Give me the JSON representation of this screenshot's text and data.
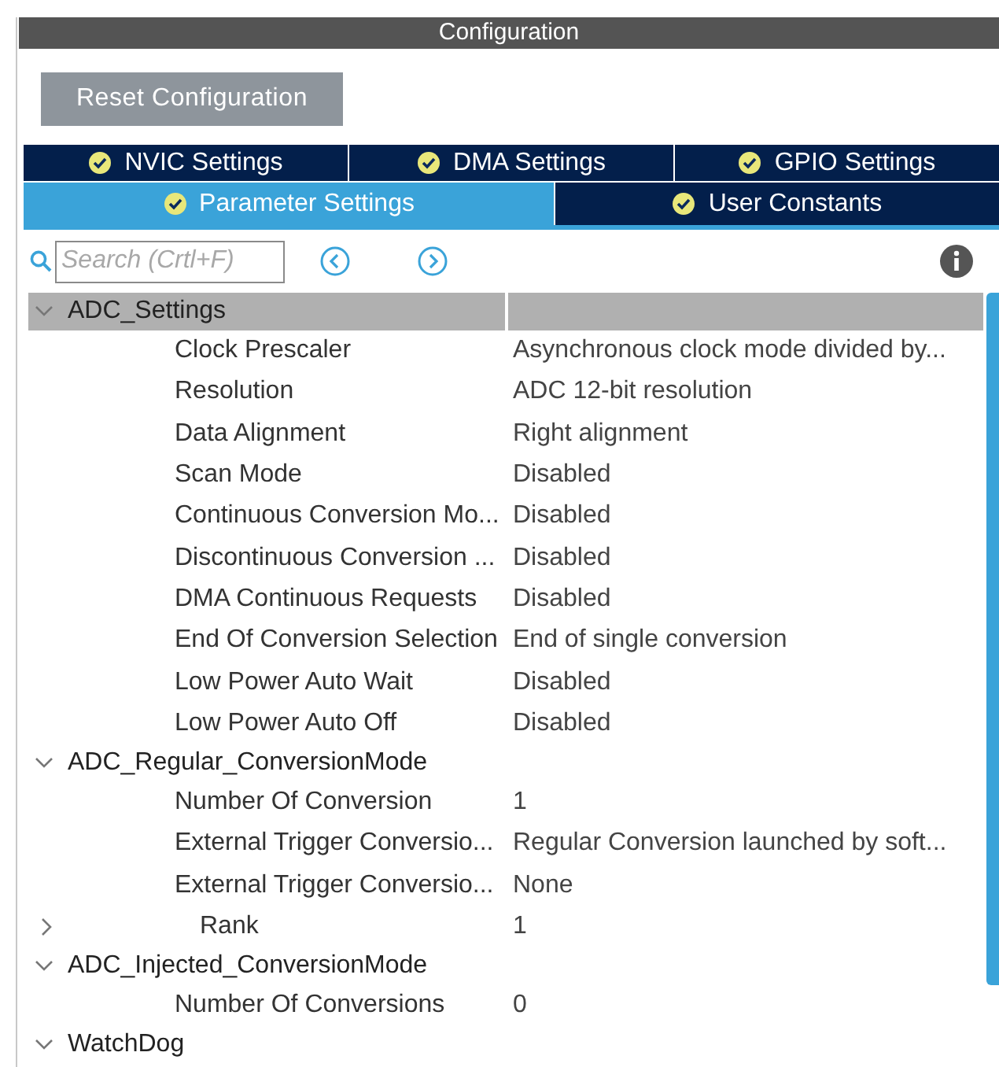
{
  "window": {
    "title": "Configuration"
  },
  "reset_button": "Reset Configuration",
  "tab_rows": [
    [
      {
        "label": "NVIC Settings",
        "selected": false
      },
      {
        "label": "DMA Settings",
        "selected": false
      },
      {
        "label": "GPIO Settings",
        "selected": false
      }
    ],
    [
      {
        "label": "Parameter Settings",
        "selected": true
      },
      {
        "label": "User Constants",
        "selected": false
      }
    ]
  ],
  "search": {
    "placeholder": "Search (Crtl+F)"
  },
  "tree": [
    {
      "label": "ADC_Settings",
      "expanded": true,
      "selected": true,
      "children": [
        {
          "label": "Clock Prescaler",
          "value": "Asynchronous clock mode divided by..."
        },
        {
          "label": "Resolution",
          "value": "ADC 12-bit resolution"
        },
        {
          "label": "Data Alignment",
          "value": "Right alignment"
        },
        {
          "label": "Scan Mode",
          "value": "Disabled"
        },
        {
          "label": "Continuous Conversion Mo...",
          "value": "Disabled"
        },
        {
          "label": "Discontinuous Conversion ...",
          "value": "Disabled"
        },
        {
          "label": "DMA Continuous Requests",
          "value": "Disabled"
        },
        {
          "label": "End Of Conversion Selection",
          "value": "End of single conversion"
        },
        {
          "label": "Low Power Auto Wait",
          "value": "Disabled"
        },
        {
          "label": "Low Power Auto Off",
          "value": "Disabled"
        }
      ]
    },
    {
      "label": "ADC_Regular_ConversionMode",
      "expanded": true,
      "selected": false,
      "children": [
        {
          "label": "Number Of Conversion",
          "value": "1"
        },
        {
          "label": "External Trigger Conversio...",
          "value": "Regular Conversion launched by soft..."
        },
        {
          "label": "External Trigger Conversio...",
          "value": "None"
        },
        {
          "label": "Rank",
          "value": "1",
          "expanded": false
        }
      ]
    },
    {
      "label": "ADC_Injected_ConversionMode",
      "expanded": true,
      "selected": false,
      "children": [
        {
          "label": "Number Of Conversions",
          "value": "0"
        }
      ]
    },
    {
      "label": "WatchDog",
      "expanded": true,
      "selected": false
    }
  ]
}
